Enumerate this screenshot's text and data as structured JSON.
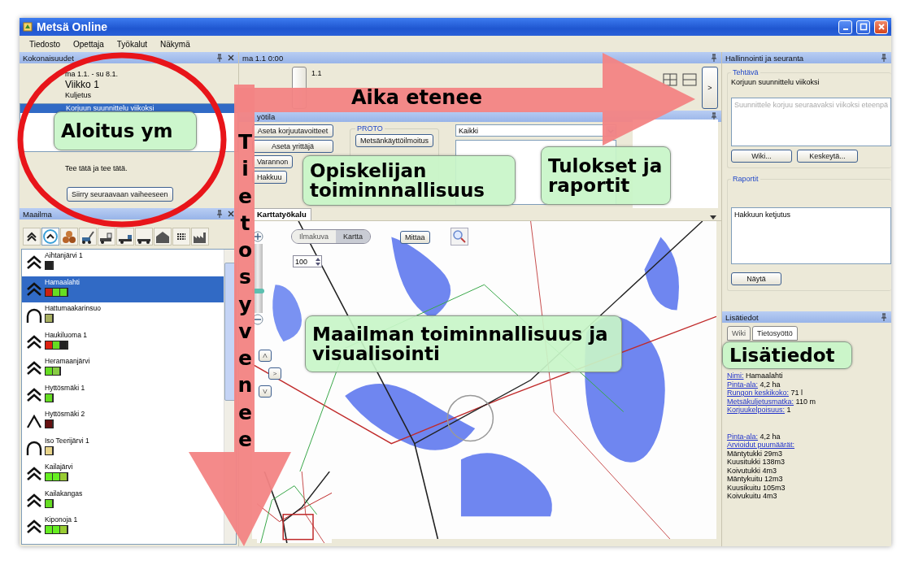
{
  "window": {
    "title": "Metsä Online"
  },
  "menu": [
    "Tiedosto",
    "Opettaja",
    "Työkalut",
    "Näkymä"
  ],
  "overview": {
    "title": "Kokonaisuudet",
    "dates": "ma 1.1. - su 8.1.",
    "week": "Viikko 1",
    "phase": "Kuljetus",
    "tasks": [
      {
        "label": "Korjuun suunnittelu viikoksi",
        "selected": true
      }
    ],
    "instructions": "Tee tätä ja tee tätä.",
    "next_button": "Siirry seuraavaan vaiheeseen"
  },
  "world": {
    "title": "Maailma",
    "tools": [
      {
        "kind": "chevron",
        "selected": false
      },
      {
        "kind": "ring",
        "selected": true
      },
      {
        "kind": "logs",
        "selected": false
      },
      {
        "kind": "harvester",
        "selected": false
      },
      {
        "kind": "forwarder",
        "selected": false
      },
      {
        "kind": "truck",
        "selected": false
      },
      {
        "kind": "trailer",
        "selected": false
      },
      {
        "kind": "house",
        "selected": false
      },
      {
        "kind": "grid",
        "selected": false
      },
      {
        "kind": "factory",
        "selected": false
      }
    ],
    "items": [
      {
        "name": "Aihtanjärvi 1",
        "kind": "double",
        "selected": false,
        "segments": [
          {
            "color": "#222222"
          }
        ]
      },
      {
        "name": "Hamaalahti",
        "kind": "double",
        "selected": true,
        "segments": [
          {
            "color": "#cc2211"
          },
          {
            "color": "#66dd22"
          },
          {
            "color": "#66dd22"
          }
        ]
      },
      {
        "name": "Hattumaakarinsuo",
        "kind": "arch",
        "selected": false,
        "segments": [
          {
            "color": "#a8b060"
          }
        ]
      },
      {
        "name": "Haukiluoma 1",
        "kind": "double",
        "selected": false,
        "segments": [
          {
            "color": "#dd2211"
          },
          {
            "color": "#66dd22"
          },
          {
            "color": "#222222"
          }
        ]
      },
      {
        "name": "Heramaanjärvi",
        "kind": "double",
        "selected": false,
        "segments": [
          {
            "color": "#66dd22"
          },
          {
            "color": "#88cc44"
          }
        ]
      },
      {
        "name": "Hyttösmäki 1",
        "kind": "double",
        "selected": false,
        "segments": [
          {
            "color": "#66dd22"
          }
        ]
      },
      {
        "name": "Hyttösmäki 2",
        "kind": "single",
        "selected": false,
        "segments": [
          {
            "color": "#661111"
          }
        ]
      },
      {
        "name": "Iso Teerijärvi 1",
        "kind": "arch",
        "selected": false,
        "segments": [
          {
            "color": "#e8d48a"
          }
        ]
      },
      {
        "name": "Kailajärvi",
        "kind": "double",
        "selected": false,
        "segments": [
          {
            "color": "#66ee22"
          },
          {
            "color": "#66ee22"
          },
          {
            "color": "#99cc33"
          }
        ]
      },
      {
        "name": "Kailakangas",
        "kind": "double",
        "selected": false,
        "segments": [
          {
            "color": "#66dd22"
          }
        ]
      },
      {
        "name": "Kiponoja 1",
        "kind": "double",
        "selected": false,
        "segments": [
          {
            "color": "#66ee22"
          },
          {
            "color": "#66ee22"
          },
          {
            "color": "#99cc33"
          }
        ]
      }
    ]
  },
  "timeline": {
    "time": "ma 1.1 0:00",
    "tick": "1.1",
    "next_button": ">"
  },
  "workspace": {
    "title": "yötila",
    "buttons": [
      "Aseta korjuutavoitteet",
      "Aseta yrittäjä",
      "Varannon",
      "Hakkuu"
    ],
    "group": {
      "title": "PROTO",
      "buttons": [
        "Metsänkäyttöilmoitus"
      ]
    },
    "filter": "Kaikki"
  },
  "map": {
    "tab": "Karttatyökalu",
    "modes": [
      {
        "label": "Ilmakuva",
        "selected": false
      },
      {
        "label": "Kartta",
        "selected": true
      }
    ],
    "measure_button": "Mittaa",
    "scale": "100",
    "zoom": {
      "level": 0.3
    },
    "nav": [
      "Λ",
      ">",
      "V"
    ]
  },
  "admin": {
    "title": "Hallinnointi ja seuranta",
    "task": {
      "title": "Tehtävä",
      "name": "Korjuun suunnittelu viikoksi",
      "description": "Suunnittele korjuu seuraavaksi viikoksi eteenpä",
      "buttons": [
        "Wiki...",
        "Keskeytä..."
      ]
    },
    "reports": {
      "title": "Raportit",
      "items": [
        "Hakkuun ketjutus"
      ],
      "button": "Näytä"
    }
  },
  "details": {
    "title": "Lisätiedot",
    "tabs": [
      {
        "label": "Wiki",
        "selected": false
      },
      {
        "label": "Tietosyöttö",
        "selected": true
      }
    ],
    "fields": [
      {
        "label": "Nimi:",
        "value": "Hamaalahti"
      },
      {
        "label": "Pinta-ala:",
        "value": "4,2 ha"
      },
      {
        "label": "Rungon keskikoko:",
        "value": "71 l"
      },
      {
        "label": "Metsäkuljetusmatka:",
        "value": "110 m"
      },
      {
        "label": "Korjuukelpoisuus:",
        "value": "1"
      }
    ],
    "volume_fields": [
      {
        "label": "Pinta-ala:",
        "value": "4,2 ha"
      },
      {
        "label": "Arvioidut puumäärät:"
      }
    ],
    "volumes": [
      "Mäntytukki 29m3",
      "Kuusitukki 138m3",
      "Koivutukki 4m3",
      "Mäntykuitu 12m3",
      "Kuusikuitu 105m3",
      "Koivukuitu 4m3"
    ]
  },
  "annotations": [
    {
      "kind": "circle"
    },
    {
      "kind": "arrow_right",
      "text": "Aika etenee"
    },
    {
      "kind": "arrow_down",
      "text": "Tieto syvenee"
    },
    {
      "kind": "callout",
      "text": "Aloitus ym"
    },
    {
      "kind": "callout",
      "text": "Opiskelijan toiminnnallisuus"
    },
    {
      "kind": "callout",
      "text": "Tulokset ja raportit"
    },
    {
      "kind": "callout",
      "text": "Maailman toiminnallisuus ja visualisointi"
    },
    {
      "kind": "callout",
      "text": "Lisätiedot"
    }
  ]
}
